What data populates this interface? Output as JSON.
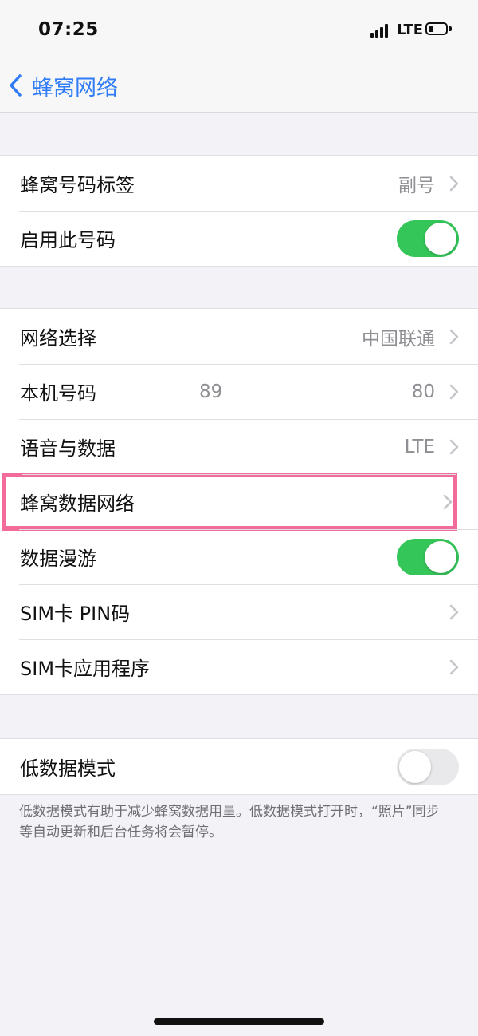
{
  "status_bar": {
    "time": "07:25",
    "network_type": "LTE"
  },
  "nav": {
    "back_label": "蜂窝网络"
  },
  "group1": {
    "rows": [
      {
        "label": "蜂窝号码标签",
        "value": "副号"
      },
      {
        "label": "启用此号码",
        "toggle_on": true
      }
    ]
  },
  "group2": {
    "rows": [
      {
        "label": "网络选择",
        "value": "中国联通"
      },
      {
        "label": "本机号码",
        "value": "89",
        "value_tail": "80"
      },
      {
        "label": "语音与数据",
        "value": "LTE"
      },
      {
        "label": "蜂窝数据网络"
      },
      {
        "label": "数据漫游",
        "toggle_on": true
      },
      {
        "label": "SIM卡 PIN码"
      },
      {
        "label": "SIM卡应用程序"
      }
    ]
  },
  "group3": {
    "rows": [
      {
        "label": "低数据模式",
        "toggle_on": false
      }
    ],
    "footer": "低数据模式有助于减少蜂窝数据用量。低数据模式打开时，“照片”同步等自动更新和后台任务将会暂停。"
  },
  "colors": {
    "accent": "#2f7cf6",
    "toggle_on": "#35c659",
    "highlight": "#f36b9a"
  },
  "icons": [
    "back-chevron-icon",
    "chevron-right-icon",
    "signal-icon",
    "battery-icon"
  ]
}
